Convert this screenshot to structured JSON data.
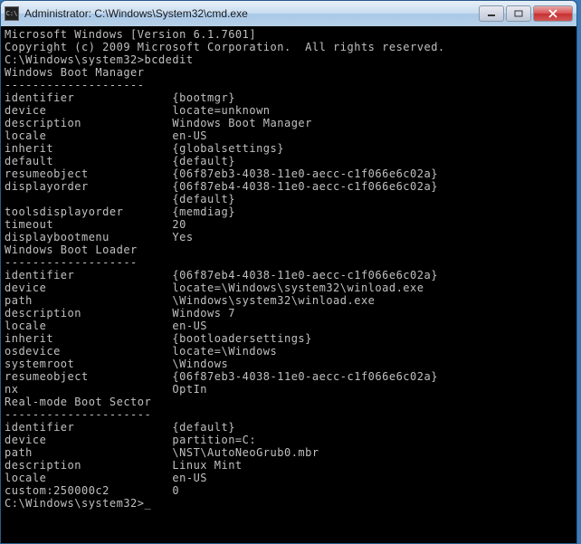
{
  "window": {
    "title": "Administrator: C:\\Windows\\System32\\cmd.exe",
    "icon_label": "C:\\"
  },
  "header": {
    "ms_windows": "Microsoft Windows [Version 6.1.7601]",
    "copyright": "Copyright (c) 2009 Microsoft Corporation.  All rights reserved."
  },
  "prompt1": {
    "path": "C:\\Windows\\system32>",
    "command": "bcdedit"
  },
  "sections": [
    {
      "title": "Windows Boot Manager",
      "entries": [
        {
          "key": "identifier",
          "value": "{bootmgr}"
        },
        {
          "key": "device",
          "value": "locate=unknown"
        },
        {
          "key": "description",
          "value": "Windows Boot Manager"
        },
        {
          "key": "locale",
          "value": "en-US"
        },
        {
          "key": "inherit",
          "value": "{globalsettings}"
        },
        {
          "key": "default",
          "value": "{default}"
        },
        {
          "key": "resumeobject",
          "value": "{06f87eb3-4038-11e0-aecc-c1f066e6c02a}"
        },
        {
          "key": "displayorder",
          "value": "{06f87eb4-4038-11e0-aecc-c1f066e6c02a}"
        },
        {
          "key": "",
          "value": "{default}"
        },
        {
          "key": "toolsdisplayorder",
          "value": "{memdiag}"
        },
        {
          "key": "timeout",
          "value": "20"
        },
        {
          "key": "displaybootmenu",
          "value": "Yes"
        }
      ]
    },
    {
      "title": "Windows Boot Loader",
      "entries": [
        {
          "key": "identifier",
          "value": "{06f87eb4-4038-11e0-aecc-c1f066e6c02a}"
        },
        {
          "key": "device",
          "value": "locate=\\Windows\\system32\\winload.exe"
        },
        {
          "key": "path",
          "value": "\\Windows\\system32\\winload.exe"
        },
        {
          "key": "description",
          "value": "Windows 7"
        },
        {
          "key": "locale",
          "value": "en-US"
        },
        {
          "key": "inherit",
          "value": "{bootloadersettings}"
        },
        {
          "key": "osdevice",
          "value": "locate=\\Windows"
        },
        {
          "key": "systemroot",
          "value": "\\Windows"
        },
        {
          "key": "resumeobject",
          "value": "{06f87eb3-4038-11e0-aecc-c1f066e6c02a}"
        },
        {
          "key": "nx",
          "value": "OptIn"
        }
      ]
    },
    {
      "title": "Real-mode Boot Sector",
      "entries": [
        {
          "key": "identifier",
          "value": "{default}"
        },
        {
          "key": "device",
          "value": "partition=C:"
        },
        {
          "key": "path",
          "value": "\\NST\\AutoNeoGrub0.mbr"
        },
        {
          "key": "description",
          "value": "Linux Mint"
        },
        {
          "key": "locale",
          "value": "en-US"
        },
        {
          "key": "custom:250000c2",
          "value": "0"
        }
      ]
    }
  ],
  "prompt2": {
    "path": "C:\\Windows\\system32>",
    "cursor": "_"
  }
}
